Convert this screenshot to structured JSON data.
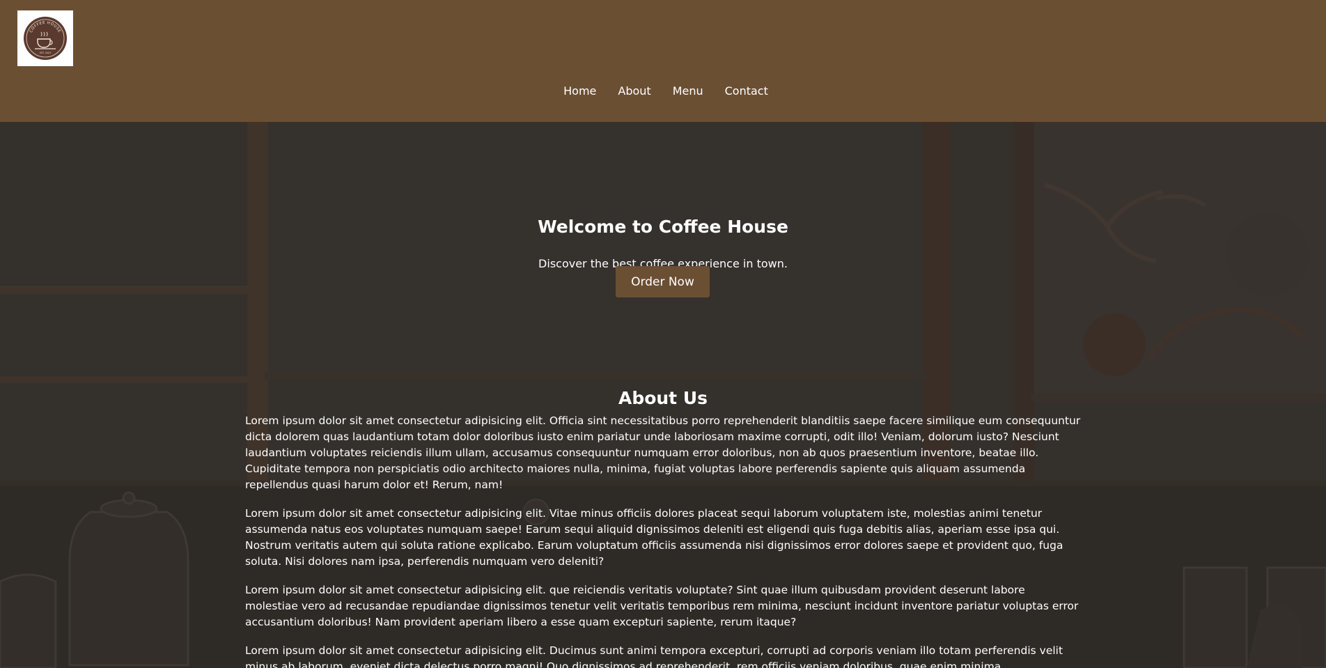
{
  "header": {
    "logo": {
      "icon": "coffee-cup-logo",
      "text_top": "COFFEE HOUSE",
      "text_bottom": "EST. 2023"
    },
    "nav": [
      {
        "label": "Home"
      },
      {
        "label": "About"
      },
      {
        "label": "Menu"
      },
      {
        "label": "Contact"
      }
    ]
  },
  "hero": {
    "title": "Welcome to Coffee House",
    "subtitle": "Discover the best coffee experience in town.",
    "button_label": "Order Now"
  },
  "about": {
    "title": "About Us",
    "paragraphs": [
      "Lorem ipsum dolor sit amet consectetur adipisicing elit. Officia sint necessitatibus porro reprehenderit blanditiis saepe facere similique eum consequuntur dicta dolorem quas laudantium totam dolor doloribus iusto enim pariatur unde laboriosam maxime corrupti, odit illo! Veniam, dolorum iusto? Nesciunt laudantium voluptates reiciendis illum ullam, accusamus consequuntur numquam error doloribus, non ab quos praesentium inventore, beatae illo. Cupiditate tempora non perspiciatis odio architecto maiores nulla, minima, fugiat voluptas labore perferendis sapiente quis aliquam assumenda repellendus quasi harum dolor et! Rerum, nam!",
      "Lorem ipsum dolor sit amet consectetur adipisicing elit. Vitae minus officiis dolores placeat sequi laborum voluptatem iste, molestias animi tenetur assumenda natus eos voluptates numquam saepe! Earum sequi aliquid dignissimos deleniti est eligendi quis fuga debitis alias, aperiam esse ipsa qui. Nostrum veritatis autem qui soluta ratione explicabo. Earum voluptatum officiis assumenda nisi dignissimos error dolores saepe et provident quo, fuga soluta. Nisi dolores nam ipsa, perferendis numquam vero deleniti?",
      "Lorem ipsum dolor sit amet consectetur adipisicing elit. que reiciendis veritatis voluptate? Sint quae illum quibusdam provident deserunt labore molestiae vero ad recusandae repudiandae dignissimos tenetur velit veritatis temporibus rem minima, nesciunt incidunt inventore pariatur voluptas error accusantium doloribus! Nam provident aperiam libero a esse quam excepturi sapiente, rerum itaque?",
      "Lorem ipsum dolor sit amet consectetur adipisicing elit. Ducimus sunt animi tempora excepturi, corrupti ad corporis veniam illo totam perferendis velit minus ab laborum, eveniet dicta delectus porro magni! Quo dignissimos ad reprehenderit, rem officiis veniam doloribus, quae enim minima"
    ]
  },
  "colors": {
    "header_bg": "#6b4f33",
    "button_bg": "#6b4f33",
    "overlay_bg": "#3a3632",
    "text": "#ffffff"
  }
}
